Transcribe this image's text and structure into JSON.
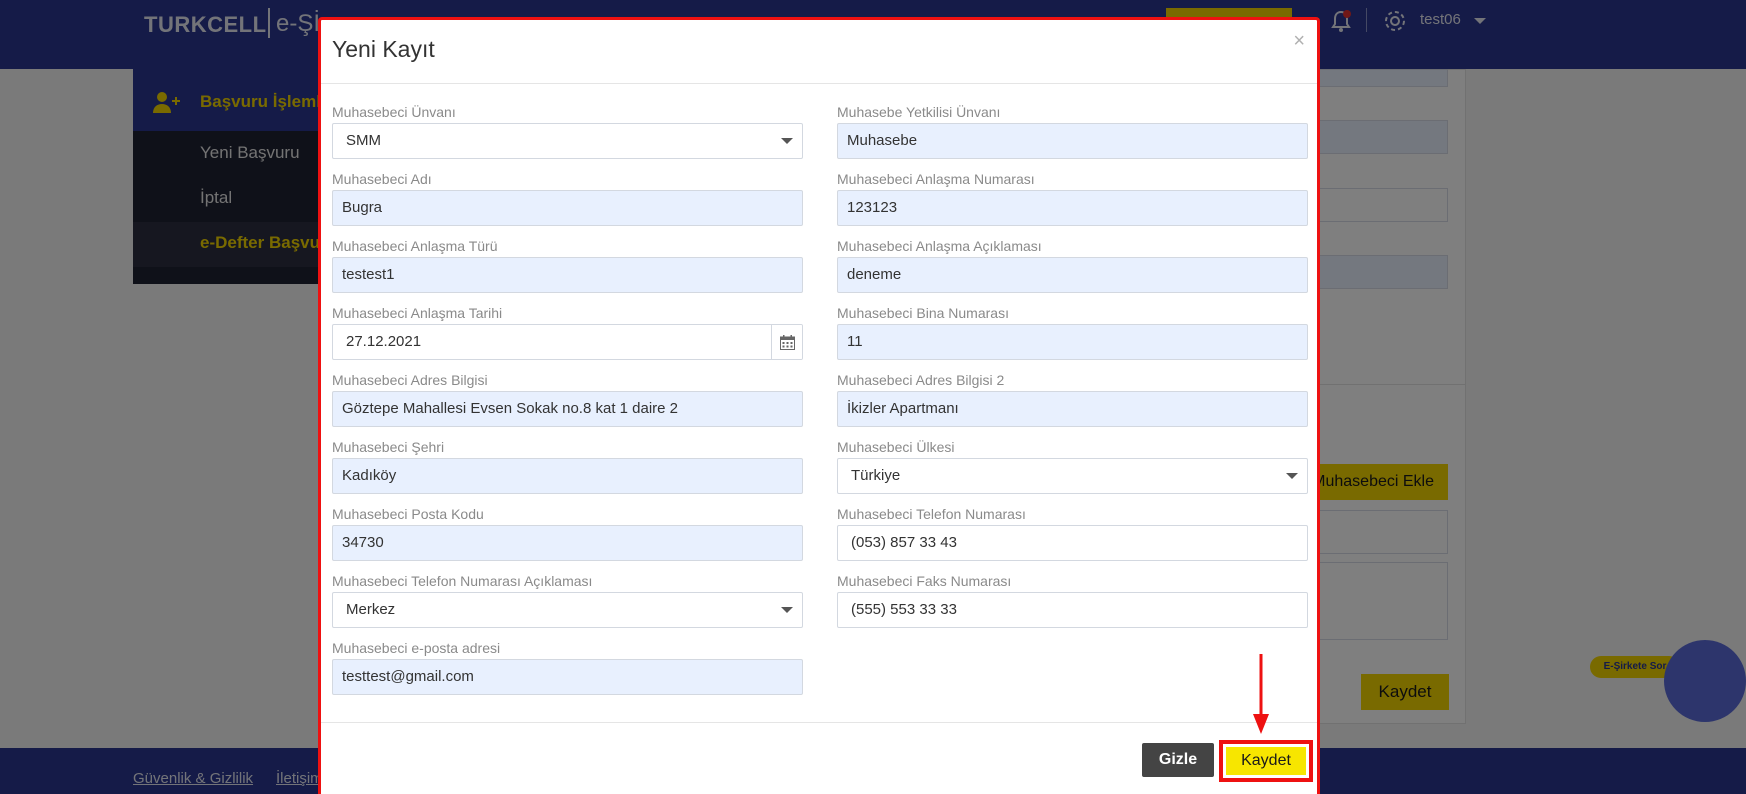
{
  "background": {
    "brand": "TURKCELL",
    "brand_sub": "e-Şİ",
    "user": "test06",
    "sidebar": {
      "header": "Başvuru İşlemleri",
      "items": [
        "Yeni Başvuru",
        "İptal",
        "e-Defter Başvurusu"
      ]
    },
    "add_button": "Muhasebeci Ekle",
    "save_button": "Kaydet",
    "footer_links": [
      "Güvenlik & Gizlilik",
      "İletişim"
    ],
    "chatbot_badge": "E-Şirkete Sor"
  },
  "modal": {
    "title": "Yeni Kayıt",
    "close": "×",
    "fields": {
      "unvan": {
        "label": "Muhasebeci Ünvanı",
        "value": "SMM"
      },
      "yetkili_unvan": {
        "label": "Muhasebe Yetkilisi Ünvanı",
        "value": "Muhasebe"
      },
      "adi": {
        "label": "Muhasebeci Adı",
        "value": "Bugra"
      },
      "anlasma_no": {
        "label": "Muhasebeci Anlaşma Numarası",
        "value": "123123"
      },
      "anlasma_turu": {
        "label": "Muhasebeci Anlaşma Türü",
        "value": "testest1"
      },
      "anlasma_aciklama": {
        "label": "Muhasebeci Anlaşma Açıklaması",
        "value": "deneme"
      },
      "anlasma_tarihi": {
        "label": "Muhasebeci Anlaşma Tarihi",
        "value": "27.12.2021"
      },
      "bina_no": {
        "label": "Muhasebeci Bina Numarası",
        "value": "11"
      },
      "adres": {
        "label": "Muhasebeci Adres Bilgisi",
        "value": "Göztepe Mahallesi Evsen Sokak no.8 kat 1 daire 2"
      },
      "adres2": {
        "label": "Muhasebeci Adres Bilgisi 2",
        "value": "İkizler Apartmanı"
      },
      "sehir": {
        "label": "Muhasebeci Şehri",
        "value": "Kadıköy"
      },
      "ulke": {
        "label": "Muhasebeci Ülkesi",
        "value": "Türkiye"
      },
      "posta_kodu": {
        "label": "Muhasebeci Posta Kodu",
        "value": "34730"
      },
      "telefon": {
        "label": "Muhasebeci Telefon Numarası",
        "value": "(053) 857 33 43"
      },
      "telefon_aciklama": {
        "label": "Muhasebeci Telefon Numarası Açıklaması",
        "value": "Merkez"
      },
      "faks": {
        "label": "Muhasebeci Faks Numarası",
        "value": "(555) 553 33 33"
      },
      "eposta": {
        "label": "Muhasebeci e-posta adresi",
        "value": "testtest@gmail.com"
      }
    },
    "buttons": {
      "hide": "Gizle",
      "save": "Kaydet"
    }
  },
  "colors": {
    "brand_blue": "#2b3790",
    "accent_yellow": "#f7e600",
    "highlight_red": "#ee1111"
  }
}
